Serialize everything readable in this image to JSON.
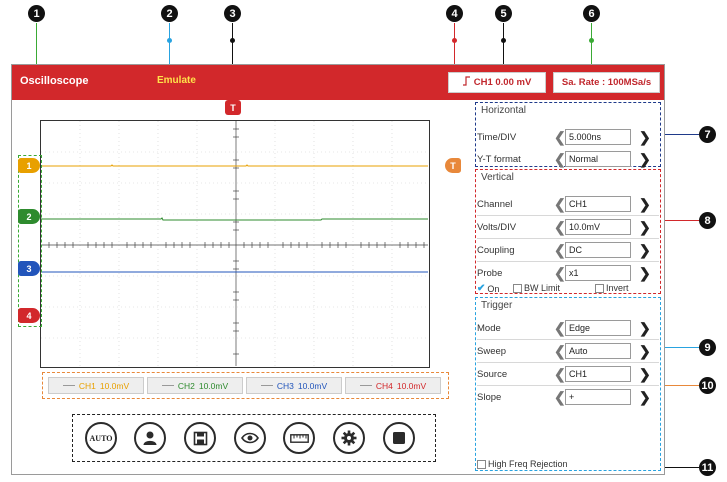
{
  "header": {
    "title": "Oscilloscope",
    "mode": "Emulate",
    "trigger_readout": "CH1 0.00 mV",
    "sample_rate": "Sa. Rate : 100MSa/s"
  },
  "callouts": [
    "1",
    "2",
    "3",
    "4",
    "5",
    "6",
    "7",
    "8",
    "9",
    "10",
    "11"
  ],
  "markers": {
    "trigger_time": "T",
    "trigger_level": "T",
    "channels": [
      "1",
      "2",
      "3",
      "4"
    ]
  },
  "channel_bar": [
    {
      "label": "CH1",
      "scale": "10.0mV",
      "color": "#e8a000"
    },
    {
      "label": "CH2",
      "scale": "10.0mV",
      "color": "#2e8b2e"
    },
    {
      "label": "CH3",
      "scale": "10.0mV",
      "color": "#2255bb"
    },
    {
      "label": "CH4",
      "scale": "10.0mV",
      "color": "#d2282b"
    }
  ],
  "toolbar": {
    "auto_label": "AUTO",
    "buttons": [
      "auto-button",
      "user-icon",
      "save-icon",
      "eye-icon",
      "ruler-icon",
      "gear-icon",
      "stop-icon"
    ]
  },
  "horizontal": {
    "title": "Horizontal",
    "time_div_label": "Time/DIV",
    "time_div_value": "5.000ns",
    "yt_format_label": "Y-T format",
    "yt_format_value": "Normal"
  },
  "vertical": {
    "title": "Vertical",
    "channel_label": "Channel",
    "channel_value": "CH1",
    "volts_div_label": "Volts/DIV",
    "volts_div_value": "10.0mV",
    "coupling_label": "Coupling",
    "coupling_value": "DC",
    "probe_label": "Probe",
    "probe_value": "x1",
    "on_label": "On",
    "bw_limit_label": "BW Limit",
    "invert_label": "Invert"
  },
  "trigger": {
    "title": "Trigger",
    "mode_label": "Mode",
    "mode_value": "Edge",
    "sweep_label": "Sweep",
    "sweep_value": "Auto",
    "source_label": "Source",
    "source_value": "CH1",
    "slope_label": "Slope",
    "slope_value": "+",
    "hf_reject_label": "High Freq Rejection"
  },
  "colors": {
    "header_red": "#d2282b",
    "ch1": "#e8a000",
    "ch2": "#2e8b2e",
    "ch3": "#2255bb",
    "ch4": "#d2282b",
    "callout_green": "#3aaa35",
    "callout_blue": "#29a3e0",
    "callout_navy": "#1f3a8a",
    "callout_orange": "#e8883a"
  }
}
